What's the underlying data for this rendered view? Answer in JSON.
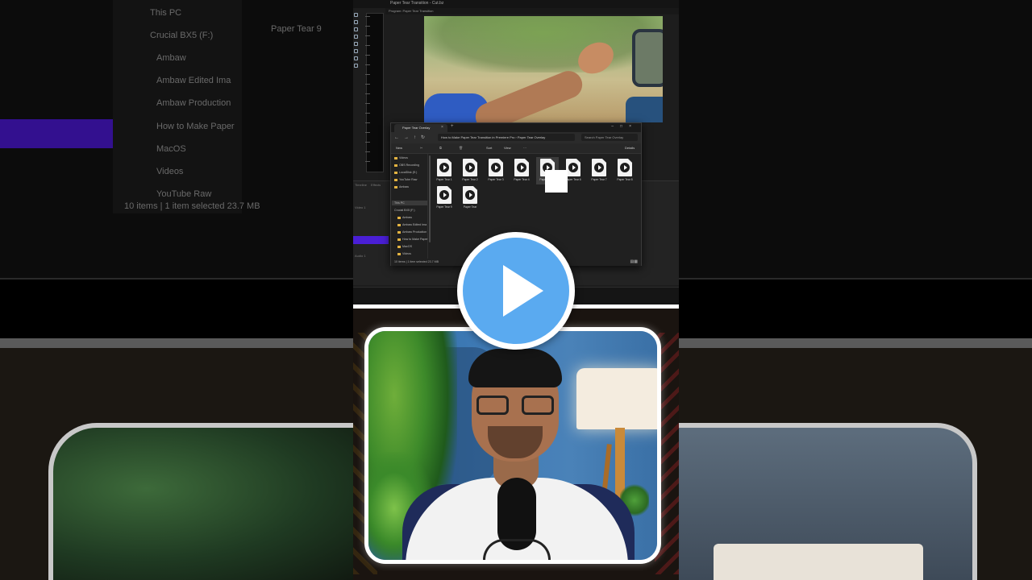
{
  "background": {
    "this_pc": "This PC",
    "drive": "Crucial BX5 (F:)",
    "folders": [
      "Ambaw",
      "Ambaw Edited Ima",
      "Ambaw Production",
      "How to Make Paper",
      "MacOS",
      "Videos",
      "YouTube Raw"
    ],
    "file_label": "Paper Tear 9",
    "status": "10 items  |  1 item selected  23.7 MB"
  },
  "premiere": {
    "window_title": "Paper Tear Transition - Cut.bz",
    "program_tab": "Program: Paper Tear Transition",
    "timeline_tabs": [
      "Timeline",
      "Effects"
    ],
    "track_labels": [
      "Video 1",
      "Audio 1"
    ]
  },
  "explorer": {
    "tab_title": "Paper Tear Overlay",
    "breadcrumb": "How to Make Paper Tear Transition in Premiere Pro  ›  Paper Tear Overlay",
    "search_placeholder": "Search Paper Tear Overlay",
    "commands": {
      "new": "New",
      "sort": "Sort",
      "view": "View",
      "details": "Details"
    },
    "nav_items": [
      "Videos",
      "OBS Recording",
      "LocalDisk (E:)",
      "YouTube Raw",
      "Ambaw",
      "This PC",
      "Crucial BX5 (F:)",
      "Ambaw",
      "Ambaw Edited Ima",
      "Ambaw Production",
      "How to Make Paper",
      "MacOS",
      "Videos",
      "YouTube Raw"
    ],
    "files": [
      "Paper Tear 1",
      "Paper Tear 2",
      "Paper Tear 3",
      "Paper Tear 4",
      "Paper Tear 5",
      "Paper Tear 6",
      "Paper Tear 7",
      "Paper Tear 8",
      "Paper Tear 9",
      "Paper Tear"
    ],
    "status": "10 items  |  1 item selected  23.7 MB"
  },
  "player": {
    "play_button": "play-icon",
    "accent_color": "#5aaaf0"
  }
}
